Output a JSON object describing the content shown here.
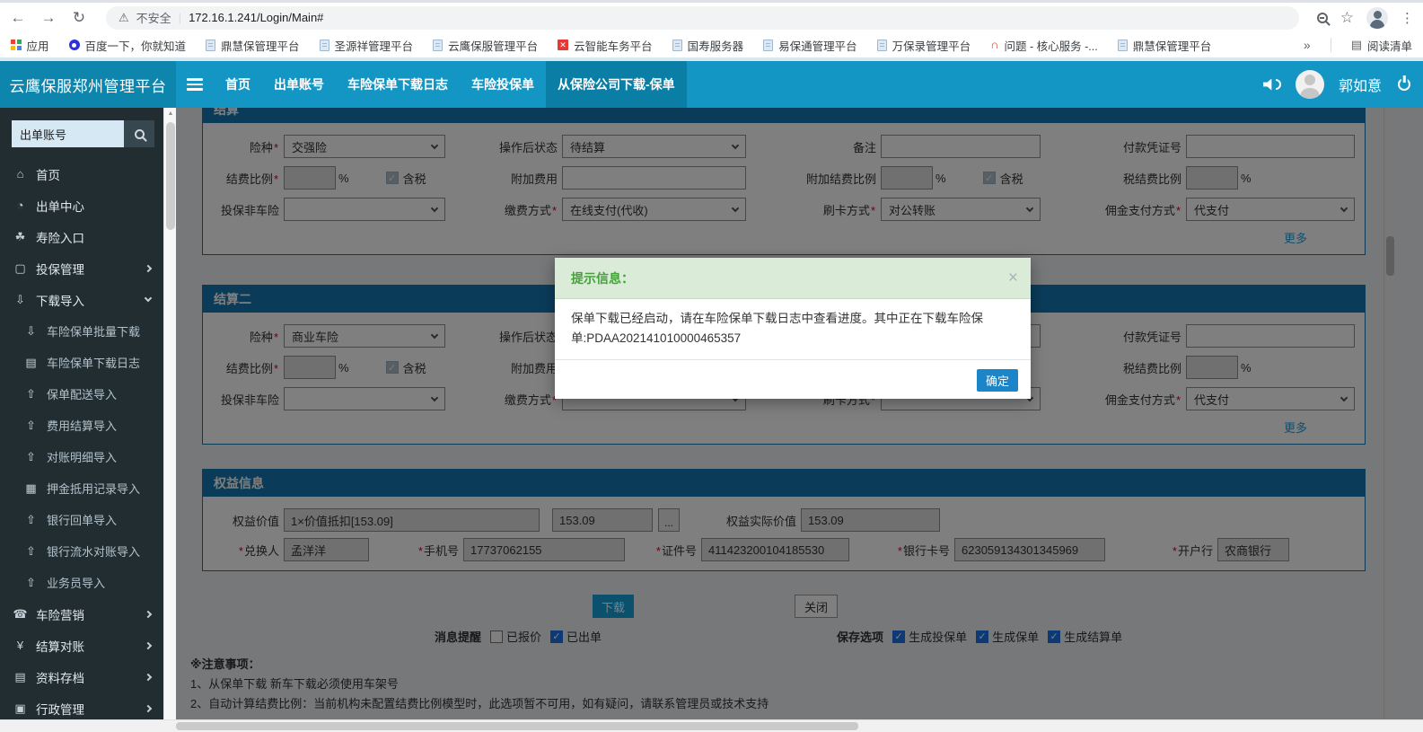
{
  "browser": {
    "security_warning": "不安全",
    "url": "172.16.1.241/Login/Main#",
    "apps_label": "应用",
    "bookmarks": [
      "百度一下，你就知道",
      "鼎慧保管理平台",
      "圣源祥管理平台",
      "云鹰保服管理平台",
      "云智能车务平台",
      "国寿服务器",
      "易保通管理平台",
      "万保录管理平台",
      "问题 - 核心服务 -...",
      "鼎慧保管理平台"
    ],
    "overflow_chevron": "»",
    "reading_list": "阅读清单"
  },
  "icons": {
    "back": "←",
    "forward": "→",
    "reload": "↻",
    "warning": "⚠",
    "star": "☆",
    "dots": "⋮",
    "x_mark": "✕",
    "arc": "∩",
    "reading_list": "▤",
    "home": "⌂",
    "issue_center": "◔",
    "life_entry": "☘",
    "insure_mgmt": "▢",
    "download_import": "⇩",
    "batch_download": "⇩",
    "download_log": "▤",
    "import": "⇧",
    "deposit_grid": "▦",
    "marketing": "☎",
    "settle_check": "¥",
    "archive": "▤",
    "admin": "▣",
    "scroll_up": "▲",
    "scroll_down": "▼"
  },
  "header": {
    "brand": "云鹰保服郑州管理平台",
    "nav": [
      "首页",
      "出单账号",
      "车险保单下载日志",
      "车险投保单",
      "从保险公司下载-保单"
    ],
    "username": "郭如意"
  },
  "sidebar": {
    "search_value": "出单账号",
    "items": [
      "首页",
      "出单中心",
      "寿险入口",
      "投保管理",
      "下载导入"
    ],
    "submenu": [
      "车险保单批量下载",
      "车险保单下载日志",
      "保单配送导入",
      "费用结算导入",
      "对账明细导入",
      "押金抵用记录导入",
      "银行回单导入",
      "银行流水对账导入",
      "业务员导入"
    ],
    "items_bottom": [
      "车险营销",
      "结算对账",
      "资料存档",
      "行政管理"
    ]
  },
  "form": {
    "labels": {
      "required_mark": "*",
      "insurance_type": "险种",
      "post_status": "操作后状态",
      "remark": "备注",
      "payment_voucher": "付款凭证号",
      "settle_ratio": "结费比例",
      "addl_fee": "附加费用",
      "addl_settle_ratio": "附加结费比例",
      "tax_settle_ratio": "税结费比例",
      "non_auto_insure": "投保非车险",
      "pay_method": "缴费方式",
      "card_method": "刷卡方式",
      "commission_pay_method": "佣金支付方式",
      "tax_included": "含税",
      "percent": "%",
      "more": "更多"
    },
    "settlement1": {
      "title": "结算",
      "insurance_type": "交强险",
      "post_status": "待结算",
      "pay_method": "在线支付(代收)",
      "card_method": "对公转账",
      "commission_pay_method": "代支付"
    },
    "settlement2": {
      "title": "结算二",
      "insurance_type": "商业车险",
      "commission_pay_method": "代支付"
    },
    "rights": {
      "title": "权益信息",
      "labels": {
        "rights_value": "权益价值",
        "rights_actual_value": "权益实际价值",
        "redeemer": "兑换人",
        "phone": "手机号",
        "id_number": "证件号",
        "bank_card": "银行卡号",
        "bank": "开户行"
      },
      "values": {
        "rights_value_desc": "1×价值抵扣[153.09]",
        "rights_value_amount": "153.09",
        "rights_actual_value": "153.09",
        "redeemer": "孟洋洋",
        "phone": "17737062155",
        "id_number": "411423200104185530",
        "bank_card": "623059134301345969",
        "bank": "农商银行"
      },
      "ellipsis_button": "..."
    }
  },
  "footer": {
    "download_button": "下载",
    "close_button": "关闭",
    "message_remind_label": "消息提醒",
    "message_remind_options": [
      {
        "label": "已报价",
        "checked": false
      },
      {
        "label": "已出单",
        "checked": true
      }
    ],
    "save_options_label": "保存选项",
    "save_options": [
      {
        "label": "生成投保单",
        "checked": true
      },
      {
        "label": "生成保单",
        "checked": true
      },
      {
        "label": "生成结算单",
        "checked": true
      }
    ],
    "notes_title": "※注意事项：",
    "notes": [
      "1、从保单下载 新车下载必须使用车架号",
      "2、自动计算结费比例：当前机构未配置结费比例模型时，此选项暂不可用，如有疑问，请联系管理员或技术支持"
    ]
  },
  "modal": {
    "title": "提示信息：",
    "close": "×",
    "message": "保单下载已经启动，请在车险保单下载日志中查看进度。其中正在下载车险保单:PDAA202141010000465357",
    "confirm_button": "确定"
  },
  "colors": {
    "header_teal": "#1396c4",
    "brand_teal": "#0e85ad",
    "active_nav": "#0b7ea6",
    "sidebar_bg": "#222d32",
    "section_header_blue": "#1478b4",
    "download_button": "#16a2da",
    "confirm_blue": "#1c85c7",
    "modal_header_green_bg": "#daecd8",
    "modal_title_green": "#44a13a",
    "link_blue": "#1e9fe0"
  }
}
